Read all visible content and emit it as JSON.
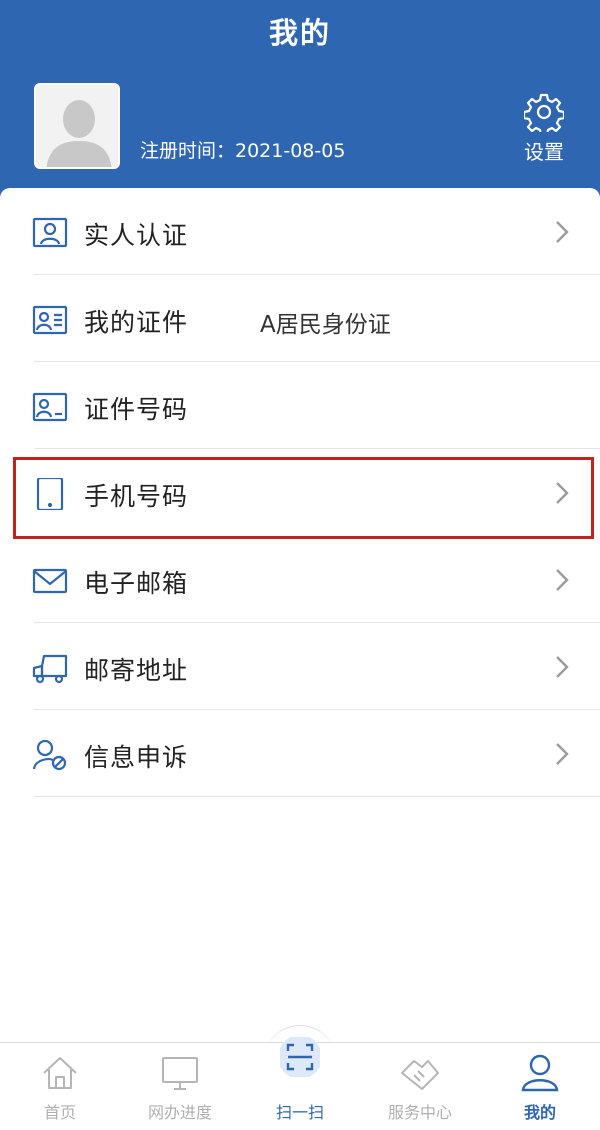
{
  "header": {
    "title": "我的",
    "reg_time": "注册时间：2021-08-05",
    "settings_label": "设置"
  },
  "menu": [
    {
      "label": "实人认证",
      "value": "",
      "icon": "person-card-icon",
      "chevron": true
    },
    {
      "label": "我的证件",
      "value": "A居民身份证",
      "icon": "id-card-icon",
      "chevron": false
    },
    {
      "label": "证件号码",
      "value": "",
      "icon": "id-number-icon",
      "chevron": false
    },
    {
      "label": "手机号码",
      "value": "",
      "icon": "phone-icon",
      "chevron": true
    },
    {
      "label": "电子邮箱",
      "value": "",
      "icon": "mail-icon",
      "chevron": true
    },
    {
      "label": "邮寄地址",
      "value": "",
      "icon": "truck-icon",
      "chevron": true
    },
    {
      "label": "信息申诉",
      "value": "",
      "icon": "user-appeal-icon",
      "chevron": true
    }
  ],
  "tabbar": [
    {
      "label": "首页",
      "icon": "home-icon",
      "active": false
    },
    {
      "label": "网办进度",
      "icon": "monitor-icon",
      "active": false
    },
    {
      "label": "扫一扫",
      "icon": "scan-icon",
      "active": false
    },
    {
      "label": "服务中心",
      "icon": "handshake-icon",
      "active": false
    },
    {
      "label": "我的",
      "icon": "profile-icon",
      "active": true
    }
  ],
  "colors": {
    "primary": "#2f66b1",
    "highlight": "#c0241c"
  }
}
